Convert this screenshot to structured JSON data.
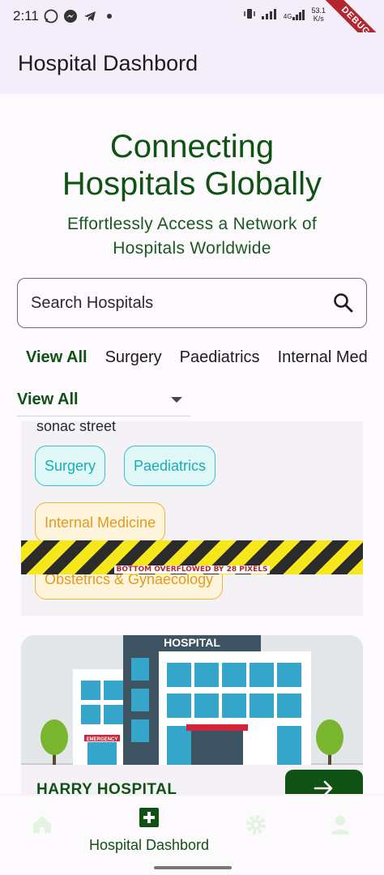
{
  "status_bar": {
    "time": "2:11",
    "net_speed_value": "53.1",
    "net_speed_unit": "K/s",
    "debug_label": "DEBUG",
    "signal_label": "4G"
  },
  "app_bar": {
    "title": "Hospital Dashbord"
  },
  "hero": {
    "title_line1": "Connecting",
    "title_line2": "Hospitals Globally",
    "subtitle_line1": "Effortlessly Access a Network of",
    "subtitle_line2": "Hospitals Worldwide"
  },
  "search": {
    "placeholder": "Search Hospitals",
    "icon": "search-icon"
  },
  "filters": {
    "chips": [
      "View All",
      "Surgery",
      "Paediatrics",
      "Internal Med"
    ],
    "selected": "View All",
    "dropdown_value": "View All"
  },
  "hospital_card_1": {
    "address": "sonac street",
    "tags": [
      "Surgery",
      "Paediatrics",
      "Internal Medicine",
      "Obstetrics & Gynaecology"
    ],
    "overflow_message": "BOTTOM OVERFLOWED BY 28 PIXELS"
  },
  "hospital_card_2": {
    "sign": "HOSPITAL",
    "emergency_sign": "EMERGENCY",
    "name": "HARRY HOSPITAL",
    "action_icon": "arrow-right-icon"
  },
  "bottom_nav": {
    "items": [
      {
        "icon": "home-icon",
        "label": ""
      },
      {
        "icon": "hospital-plus-icon",
        "label": "Hospital Dashbord"
      },
      {
        "icon": "gear-icon",
        "label": ""
      },
      {
        "icon": "person-icon",
        "label": ""
      }
    ],
    "active_color": "#0f5213",
    "inactive_color": "#e3f4e0"
  },
  "colors": {
    "primary_green": "#0f5213",
    "teal": "#19aeb3",
    "amber": "#e49a1a",
    "app_bar_bg": "#f3eef9"
  }
}
